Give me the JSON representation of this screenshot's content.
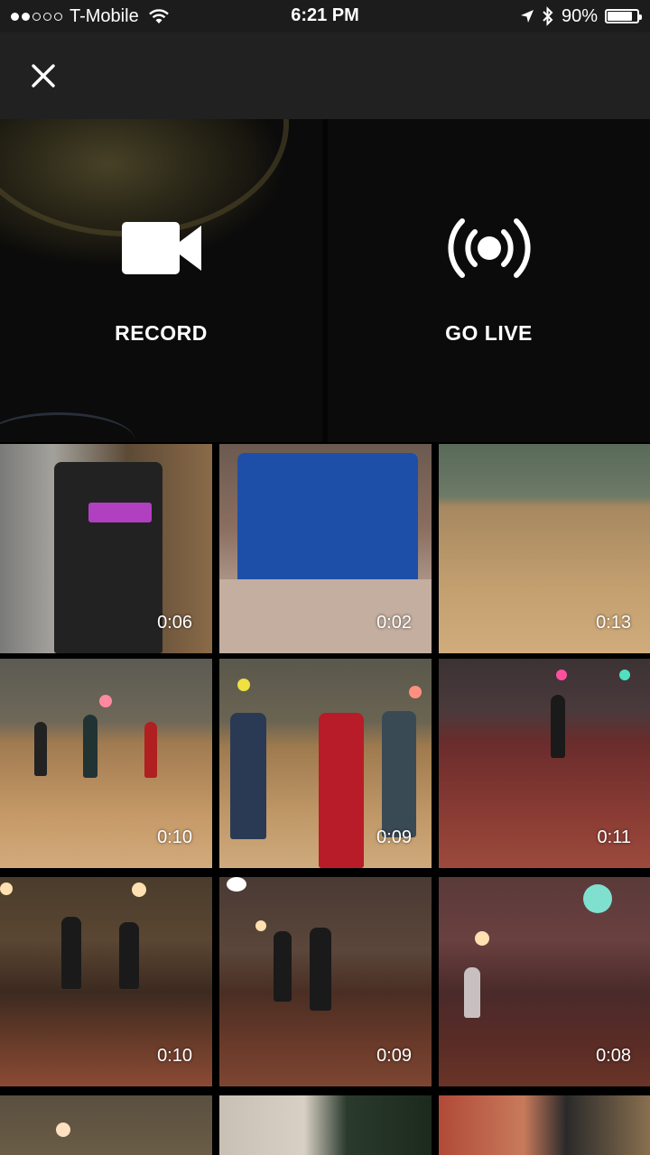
{
  "status_bar": {
    "carrier": "T-Mobile",
    "time": "6:21 PM",
    "battery": "90%",
    "battery_level": 0.9,
    "signal_bars": 2
  },
  "top_bar": {
    "close_icon": "close-icon"
  },
  "camera": {
    "record_label": "RECORD",
    "record_icon": "video-camera-icon",
    "live_label": "GO LIVE",
    "live_icon": "broadcast-icon"
  },
  "gallery": {
    "videos": [
      {
        "duration": "0:06"
      },
      {
        "duration": "0:02"
      },
      {
        "duration": "0:13"
      },
      {
        "duration": "0:10"
      },
      {
        "duration": "0:09"
      },
      {
        "duration": "0:11"
      },
      {
        "duration": "0:10"
      },
      {
        "duration": "0:09"
      },
      {
        "duration": "0:08"
      },
      {
        "duration": ""
      },
      {
        "duration": ""
      },
      {
        "duration": ""
      }
    ]
  },
  "colors": {
    "background": "#1c1c1c",
    "top_bar": "#212121",
    "text": "#ffffff"
  }
}
